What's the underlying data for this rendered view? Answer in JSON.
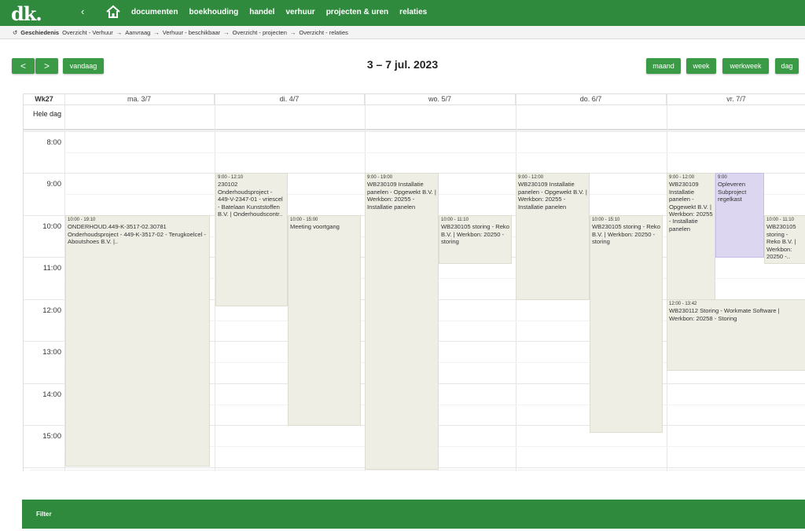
{
  "app": {
    "logo": "dk."
  },
  "nav": {
    "back_icon": "chevron-left-icon",
    "home_icon": "home-icon",
    "items": [
      "documenten",
      "boekhouding",
      "handel",
      "verhuur",
      "projecten & uren",
      "relaties"
    ]
  },
  "breadcrumb": {
    "history_label": "Geschiedenis",
    "items": [
      "Overzicht - Verhuur",
      "Aanvraag",
      "Verhuur - beschikbaar",
      "Overzicht - projecten",
      "Overzicht - relaties"
    ],
    "separator": "→"
  },
  "toolbar": {
    "prev": "<",
    "next": ">",
    "today": "vandaag",
    "range_title": "3 – 7 jul. 2023",
    "views": [
      "maand",
      "week",
      "werkweek",
      "dag"
    ]
  },
  "calendar": {
    "week_label": "Wk27",
    "allday_label": "Hele dag",
    "days": [
      "ma. 3/7",
      "di. 4/7",
      "wo. 5/7",
      "do. 6/7",
      "vr. 7/7"
    ],
    "hours": [
      "8:00",
      "9:00",
      "10:00",
      "11:00",
      "12:00",
      "13:00",
      "14:00",
      "15:00"
    ],
    "events": [
      {
        "time": "10:00 - 19:10",
        "desc": "ONDERHOUD.449-K-3517-02.30781 Onderhoudsproject - 449-K-3517-02 - Terugkoelcel - Aboutshoes B.V. |.."
      },
      {
        "time": "9:00 - 12:10",
        "desc": "230102 Onderhoudsproject - 449-V-2347-01 - vriescel - Batelaan Kunststoffen B.V. | Onderhoudscontr.."
      },
      {
        "time": "10:00 - 15:00",
        "desc": "Meeting voortgang"
      },
      {
        "time": "9:00 - 19:00",
        "desc": "WB230109 Installatie panelen - Opgewekt B.V. | Werkbon: 20255 - Installatie panelen"
      },
      {
        "time": "10:00 - 11:10",
        "desc": "WB230105 storing - Reko B.V. | Werkbon: 20250 - storing"
      },
      {
        "time": "9:00 - 12:00",
        "desc": "WB230109 Installatie panelen - Opgewekt B.V. | Werkbon: 20255 - Installatie panelen"
      },
      {
        "time": "10:00 - 15:10",
        "desc": "WB230105 storing - Reko B.V. | Werkbon: 20250 - storing"
      },
      {
        "time": "9:00 - 12:00",
        "desc": "WB230109 Installatie panelen - Opgewekt B.V. | Werkbon: 20255 - Installatie panelen"
      },
      {
        "time": "9:00",
        "desc": "Opleveren Subproject regelkast"
      },
      {
        "time": "10:00 - 11:10",
        "desc": "WB230105 storing - Reko B.V. | Werkbon: 20250 -.."
      },
      {
        "time": "12:00 - 13:42",
        "desc": "WB230112 Storing - Workmate Software | Werkbon: 20258 - Storing"
      }
    ]
  },
  "footer": {
    "filter_label": "Filter"
  },
  "colors": {
    "brand_green": "#2f8a3e",
    "button_green": "#3a9a45",
    "event_bg": "#eeeee4",
    "event_purple": "#ddd6f0"
  }
}
